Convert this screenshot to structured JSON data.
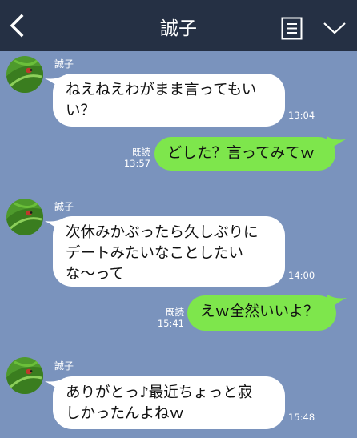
{
  "header": {
    "title": "誠子",
    "back_icon": "chevron-left-icon",
    "notes_icon": "notes-list-icon",
    "menu_icon": "chevron-down-icon",
    "background": "#253044"
  },
  "colors": {
    "chat_background": "#7a93bd",
    "incoming_bubble": "#ffffff",
    "outgoing_bubble": "#7ee64c"
  },
  "messages": [
    {
      "direction": "incoming",
      "sender": "誠子",
      "text": "ねえねえわがまま言ってもいい？",
      "time": "13:04"
    },
    {
      "direction": "outgoing",
      "text": "どした？言ってみてｗ",
      "read_label": "既読",
      "time": "13:57"
    },
    {
      "direction": "incoming",
      "sender": "誠子",
      "text": "次休みかぶったら久しぶりにデートみたいなことしたいな〜って",
      "time": "14:00"
    },
    {
      "direction": "outgoing",
      "text": "えｗ全然いいよ？",
      "read_label": "既読",
      "time": "15:41"
    },
    {
      "direction": "incoming",
      "sender": "誠子",
      "text": "ありがとっ♪最近ちょっと寂しかったんよねｗ",
      "time": "15:48"
    }
  ]
}
